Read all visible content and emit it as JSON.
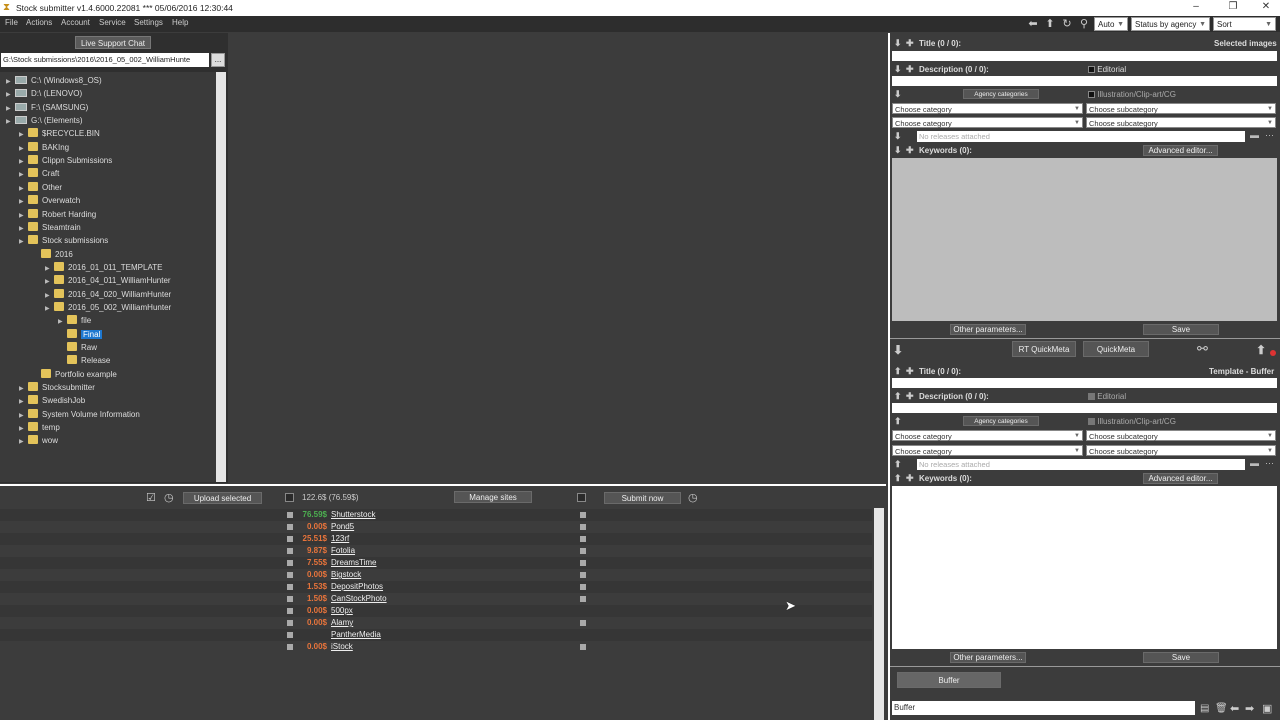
{
  "titlebar": {
    "title": "Stock submitter v1.4.6000.22081 *** 05/06/2016 12:30:44",
    "minimize": "–",
    "restore": "❐",
    "close": "✕"
  },
  "menu": [
    "File",
    "Actions",
    "Account",
    "Service",
    "Settings",
    "Help"
  ],
  "toolbar": {
    "auto": "Auto",
    "status": "Status by agency",
    "sort": "Sort"
  },
  "left": {
    "live_chat": "Live Support Chat",
    "path": "G:\\Stock submissions\\2016\\2016_05_002_WilliamHunte",
    "path_btn": "..."
  },
  "tree": [
    {
      "label": "C:\\ (Windows8_OS)",
      "lvl": 0,
      "type": "drive"
    },
    {
      "label": "D:\\ (LENOVO)",
      "lvl": 0,
      "type": "drive"
    },
    {
      "label": "F:\\ (SAMSUNG)",
      "lvl": 0,
      "type": "drive"
    },
    {
      "label": "G:\\ (Elements)",
      "lvl": 0,
      "type": "drive"
    },
    {
      "label": "$RECYCLE.BIN",
      "lvl": 1,
      "type": "folder"
    },
    {
      "label": "BAKIng",
      "lvl": 1,
      "type": "folder"
    },
    {
      "label": "Clippn Submissions",
      "lvl": 1,
      "type": "folder"
    },
    {
      "label": "Craft",
      "lvl": 1,
      "type": "folder"
    },
    {
      "label": "Other",
      "lvl": 1,
      "type": "folder"
    },
    {
      "label": "Overwatch",
      "lvl": 1,
      "type": "folder"
    },
    {
      "label": "Robert Harding",
      "lvl": 1,
      "type": "folder"
    },
    {
      "label": "Steamtrain",
      "lvl": 1,
      "type": "folder"
    },
    {
      "label": "Stock submissions",
      "lvl": 1,
      "type": "folder"
    },
    {
      "label": "2016",
      "lvl": 2,
      "type": "folder"
    },
    {
      "label": "2016_01_011_TEMPLATE",
      "lvl": 3,
      "type": "folder"
    },
    {
      "label": "2016_04_011_WilliamHunter",
      "lvl": 3,
      "type": "folder"
    },
    {
      "label": "2016_04_020_WilliamHunter",
      "lvl": 3,
      "type": "folder"
    },
    {
      "label": "2016_05_002_WilliamHunter",
      "lvl": 3,
      "type": "folder"
    },
    {
      "label": "file",
      "lvl": 4,
      "type": "folder"
    },
    {
      "label": "Final",
      "lvl": 4,
      "type": "folder",
      "selected": true
    },
    {
      "label": "Raw",
      "lvl": 4,
      "type": "folder"
    },
    {
      "label": "Release",
      "lvl": 4,
      "type": "folder"
    },
    {
      "label": "Portfolio example",
      "lvl": 2,
      "type": "folder"
    },
    {
      "label": "Stocksubmitter",
      "lvl": 1,
      "type": "folder"
    },
    {
      "label": "SwedishJob",
      "lvl": 1,
      "type": "folder"
    },
    {
      "label": "System Volume Information",
      "lvl": 1,
      "type": "folder"
    },
    {
      "label": "temp",
      "lvl": 1,
      "type": "folder"
    },
    {
      "label": "wow",
      "lvl": 1,
      "type": "folder"
    }
  ],
  "meta_top": {
    "title": "Title (0 / 0):",
    "selected_images": "Selected images",
    "description": "Description (0 / 0):",
    "editorial": "Editorial",
    "agency_categories": "Agency categories",
    "illustration": "Illustration/Clip-art/CG",
    "choose_category": "Choose category",
    "choose_subcategory": "Choose subcategory",
    "no_releases": "No releases attached",
    "keywords": "Keywords (0):",
    "advanced_editor": "Advanced editor...",
    "other_params": "Other parameters...",
    "save": "Save"
  },
  "quick": {
    "rt_quickmeta": "RT QuickMeta",
    "quickmeta": "QuickMeta"
  },
  "meta_bottom": {
    "title": "Title (0 / 0):",
    "template_buffer": "Template - Buffer",
    "description": "Description (0 / 0):",
    "editorial": "Editorial",
    "agency_categories": "Agency categories",
    "illustration": "Illustration/Clip-art/CG",
    "choose_category": "Choose category",
    "choose_subcategory": "Choose subcategory",
    "no_releases": "No releases attached",
    "keywords": "Keywords (0):",
    "advanced_editor": "Advanced editor...",
    "other_params": "Other parameters...",
    "save": "Save",
    "buffer_btn": "Buffer",
    "buffer_input": "Buffer"
  },
  "upload": {
    "upload_selected": "Upload selected",
    "total": "122.6$ (76.59$)",
    "manage_sites": "Manage sites",
    "submit_now": "Submit now"
  },
  "sites": [
    {
      "price": "76.59$",
      "name": "Shutterstock",
      "color": "#4caf50",
      "right_chk": true
    },
    {
      "price": "0.00$",
      "name": "Pond5",
      "color": "#e8743b",
      "right_chk": true
    },
    {
      "price": "25.51$",
      "name": "123rf",
      "color": "#e8743b",
      "right_chk": true
    },
    {
      "price": "9.87$",
      "name": "Fotolia",
      "color": "#e8743b",
      "right_chk": true
    },
    {
      "price": "7.55$",
      "name": "DreamsTime",
      "color": "#e8743b",
      "right_chk": true
    },
    {
      "price": "0.00$",
      "name": "Bigstock",
      "color": "#e8743b",
      "right_chk": true
    },
    {
      "price": "1.53$",
      "name": "DepositPhotos",
      "color": "#e8743b",
      "right_chk": true
    },
    {
      "price": "1.50$",
      "name": "CanStockPhoto",
      "color": "#e8743b",
      "right_chk": true
    },
    {
      "price": "0.00$",
      "name": "500px",
      "color": "#e8743b",
      "right_chk": false
    },
    {
      "price": "0.00$",
      "name": "Alamy",
      "color": "#e8743b",
      "right_chk": true
    },
    {
      "price": "",
      "name": "PantherMedia",
      "color": "#e8743b",
      "right_chk": false
    },
    {
      "price": "0.00$",
      "name": "iStock",
      "color": "#e8743b",
      "right_chk": true
    }
  ]
}
